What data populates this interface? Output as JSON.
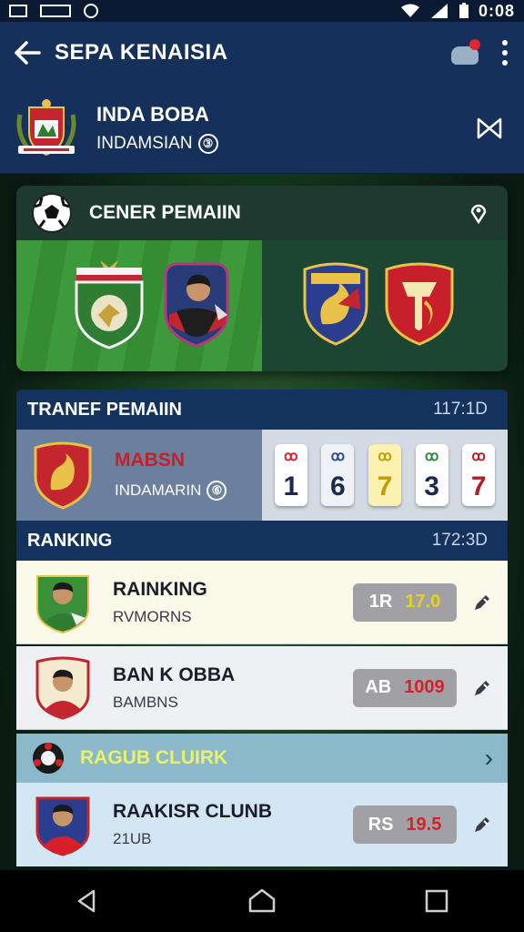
{
  "status_bar": {
    "time": "0:08"
  },
  "app_bar": {
    "title": "SEPA KENAISIA"
  },
  "club": {
    "name": "INDA BOBA",
    "subtitle": "INDAMSIAN",
    "badge": "③"
  },
  "match": {
    "title": "CENER PEMAIIN"
  },
  "transfer": {
    "title": "TRANEF PEMAIIN",
    "code": "117:1D",
    "team_name": "MABSN",
    "team_sub": "INDAMARIN",
    "team_badge": "⑥",
    "scores": [
      {
        "top": "ꝏ",
        "value": "1",
        "color": "#d8202a",
        "bg": "#ffffff"
      },
      {
        "top": "ꝏ",
        "value": "6",
        "color": "#2a4a8a",
        "bg": "#eef1f6"
      },
      {
        "top": "ꝏ",
        "value": "7",
        "color": "#c49a00",
        "bg": "#fbf1b0"
      },
      {
        "top": "ꝏ",
        "value": "3",
        "color": "#2a8a3a",
        "bg": "#ffffff"
      },
      {
        "top": "ꝏ",
        "value": "7",
        "color": "#b01e28",
        "bg": "#ffffff"
      }
    ]
  },
  "ranking": {
    "title": "RANKING",
    "code": "172:3D",
    "rows": [
      {
        "name": "RAINKING",
        "sub": "RVMORNS",
        "pill_a": "1R",
        "pill_b": "17.0",
        "bg": "#fbf9ea"
      },
      {
        "name": "BAN K OBBA",
        "sub": "BAMBNS",
        "pill_a": "AB",
        "pill_b": "1009",
        "bg": "#eef0f4"
      }
    ]
  },
  "group": {
    "label": "RAGUB CLUIRK"
  },
  "club_row": {
    "name": "RAAKISR CLUNB",
    "sub": "21UB",
    "pill_a": "RS",
    "pill_b": "19.5",
    "bg": "#d2e6f4"
  }
}
